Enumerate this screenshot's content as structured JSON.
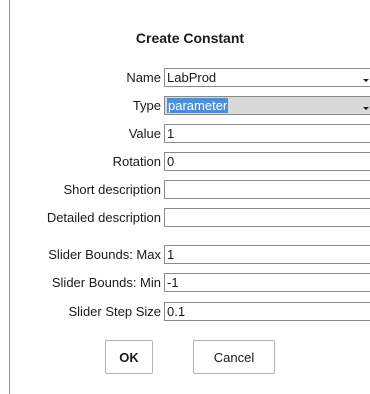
{
  "dialog": {
    "title": "Create Constant"
  },
  "fields": {
    "name": {
      "label": "Name",
      "value": "LabProd"
    },
    "type": {
      "label": "Type",
      "value": "parameter"
    },
    "value": {
      "label": "Value",
      "value": "1"
    },
    "rotation": {
      "label": "Rotation",
      "value": "0"
    },
    "short_description": {
      "label": "Short description",
      "value": ""
    },
    "detailed_description": {
      "label": "Detailed description",
      "value": ""
    },
    "slider_max": {
      "label": "Slider Bounds: Max",
      "value": "1"
    },
    "slider_min": {
      "label": "Slider Bounds: Min",
      "value": "-1"
    },
    "slider_step": {
      "label": "Slider Step Size",
      "value": "0.1"
    }
  },
  "buttons": {
    "ok_label": "OK",
    "cancel_label": "Cancel"
  },
  "icons": {
    "combo_arrow": "chevron-down-icon"
  }
}
